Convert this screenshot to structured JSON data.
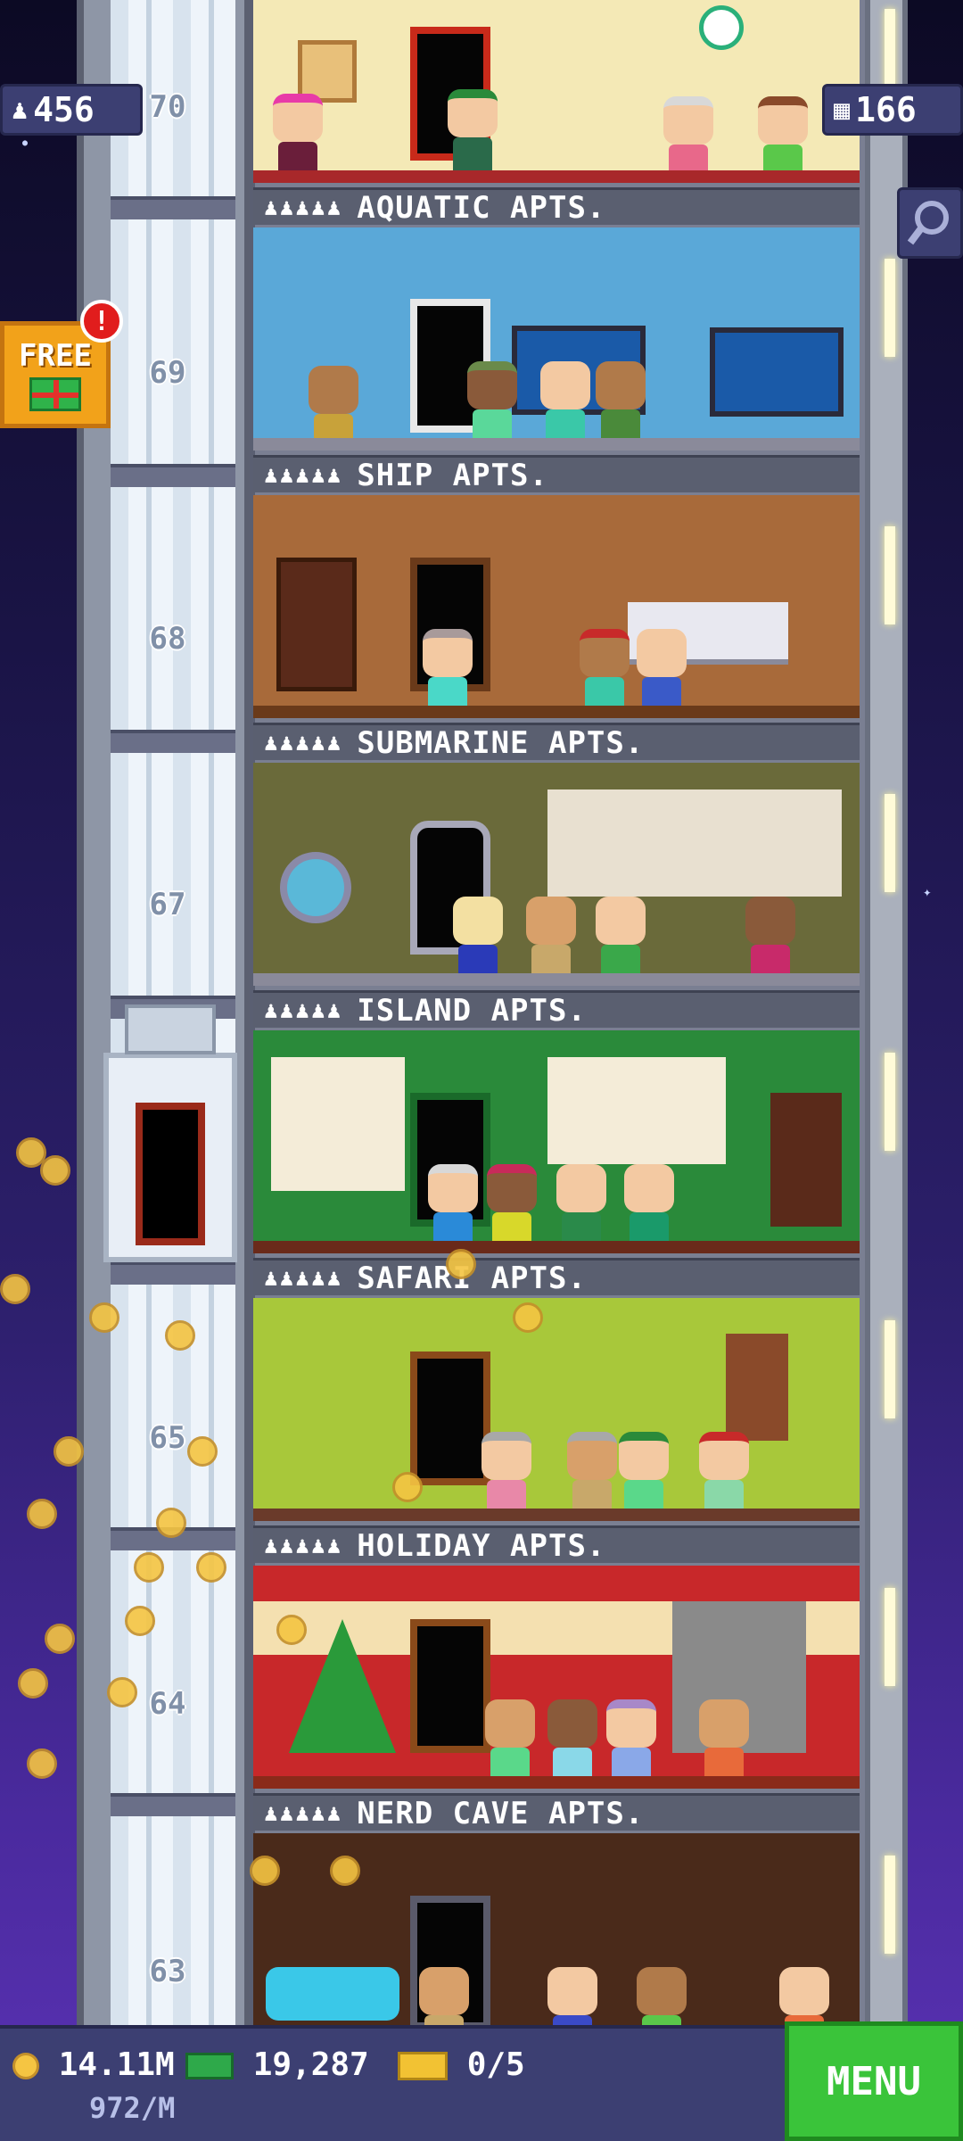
{
  "hud": {
    "population": "456",
    "floors": "166",
    "gift_label": "FREE",
    "gift_badge": "!"
  },
  "floor_numbers": [
    "70",
    "69",
    "68",
    "67",
    "65",
    "64",
    "63"
  ],
  "floors": [
    {
      "name": "AQUATIC APTS.",
      "people": "♟♟♟♟♟",
      "color": "#5aa8d8"
    },
    {
      "name": "SHIP APTS.",
      "people": "♟♟♟♟♟",
      "color": "#a86a3a"
    },
    {
      "name": "SUBMARINE APTS.",
      "people": "♟♟♟♟♟",
      "color": "#6a6a3a"
    },
    {
      "name": "ISLAND APTS.",
      "people": "♟♟♟♟♟",
      "color": "#2a8a3a"
    },
    {
      "name": "SAFARI APTS.",
      "people": "♟♟♟♟♟",
      "color": "#a8c83a"
    },
    {
      "name": "HOLIDAY APTS.",
      "people": "♟♟♟♟♟",
      "color": "#c8282a"
    },
    {
      "name": "NERD CAVE APTS.",
      "people": "♟♟♟♟♟",
      "color": "#4a2a1a"
    }
  ],
  "bottom": {
    "coins": "14.11M",
    "coins_rate": "972/M",
    "bux": "19,287",
    "tickets": "0/5",
    "menu_label": "MENU"
  }
}
